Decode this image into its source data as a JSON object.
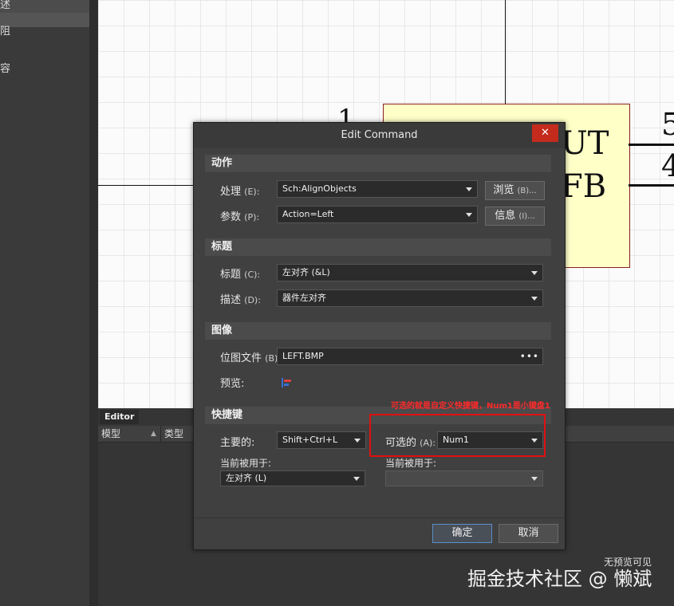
{
  "left_panel": {
    "items": [
      "述",
      "阻",
      "容"
    ]
  },
  "schematic": {
    "pin_numbers": [
      "1",
      "5",
      "4"
    ],
    "component_labels": [
      "UT",
      "FB"
    ]
  },
  "editor_panel": {
    "tab": "Editor",
    "columns": [
      "模型",
      "类型"
    ]
  },
  "dialog": {
    "title": "Edit Command",
    "close_symbol": "✕",
    "sections": {
      "action": "动作",
      "caption": "标题",
      "image": "图像",
      "shortcuts": "快捷键"
    },
    "action": {
      "process_label": "处理",
      "process_accel": "(E):",
      "process_value": "Sch:AlignObjects",
      "browse_label": "浏览",
      "browse_accel": "(B)...",
      "params_label": "参数",
      "params_accel": "(P):",
      "params_value": "Action=Left",
      "info_label": "信息",
      "info_accel": "(I)..."
    },
    "caption": {
      "title_label": "标题",
      "title_accel": "(C):",
      "title_value": "左对齐 (&L)",
      "desc_label": "描述",
      "desc_accel": "(D):",
      "desc_value": "器件左对齐"
    },
    "image": {
      "bitmap_label": "位图文件",
      "bitmap_accel": "(B):",
      "bitmap_value": "LEFT.BMP",
      "ellipsis": "•••",
      "preview_label": "预览:"
    },
    "shortcuts": {
      "primary_label": "主要的:",
      "primary_value": "Shift+Ctrl+L",
      "alt_label": "可选的",
      "alt_accel": "(A):",
      "alt_value": "Num1",
      "used_by_label_1": "当前被用于:",
      "used_by_value_1": "左对齐 (L)",
      "used_by_label_2": "当前被用于:",
      "used_by_value_2": ""
    },
    "ok_button": "确定",
    "cancel_button": "取消"
  },
  "annotation": {
    "text": "可选的就是自定义快捷键，Num1是小键盘1",
    "color": "#e01010"
  },
  "watermark": {
    "small": "无预览可见",
    "main": "掘金技术社区 @ 懒斌"
  }
}
